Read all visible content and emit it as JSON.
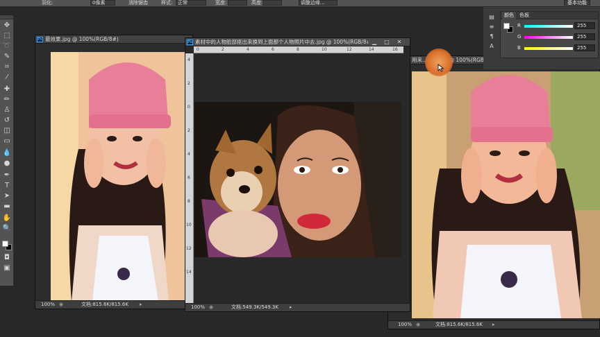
{
  "options_bar": {
    "feather_label": "羽化:",
    "feather_value": "0像素",
    "antialias_label": "消除锯齿",
    "style_label": "样式:",
    "style_value": "正常",
    "width_label": "宽度:",
    "height_label": "高度:",
    "refine_label": "调整边缘...",
    "workspace": "基本功能"
  },
  "windows": [
    {
      "id": "left",
      "title": "最效果.jpg @ 100%(RGB/8#)",
      "zoom": "100%",
      "doc_size": "文档:815.6K/815.6K"
    },
    {
      "id": "middle",
      "title": "素材中的人物脸部抠出来换到上面那个人物照片中去.jpg @ 100%(RGB/8#)",
      "zoom": "100%",
      "doc_size": "文档:549.3K/549.3K",
      "ruler_h_ticks": [
        "0",
        "2",
        "4",
        "6",
        "8",
        "10",
        "12",
        "14",
        "16"
      ],
      "ruler_v_ticks": [
        "4",
        "2",
        "0",
        "2",
        "4",
        "6",
        "8",
        "10",
        "12",
        "14"
      ]
    },
    {
      "id": "right",
      "title": "用来...素材.jpg @ 100%(RGB/8#)",
      "zoom": "100%",
      "doc_size": "文档:815.6K/815.6K"
    }
  ],
  "color_panel": {
    "tab_color": "颜色",
    "tab_swatches": "色板",
    "channels": [
      {
        "name": "R",
        "value": "255",
        "color": "#ff3030"
      },
      {
        "name": "G",
        "value": "255",
        "color": "#30ff30"
      },
      {
        "name": "B",
        "value": "255",
        "color": "#3030ff"
      }
    ]
  },
  "foreground_color": "#ffffff",
  "background_color": "#000000"
}
